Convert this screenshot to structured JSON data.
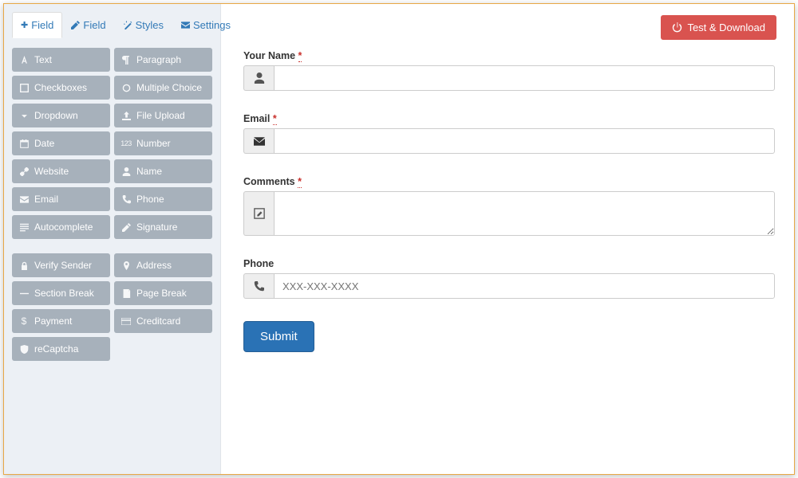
{
  "tabs": [
    {
      "icon": "plus",
      "label": "Field"
    },
    {
      "icon": "edit",
      "label": "Field"
    },
    {
      "icon": "wand",
      "label": "Styles"
    },
    {
      "icon": "envelope",
      "label": "Settings"
    }
  ],
  "activeTab": 0,
  "fieldButtons1": [
    {
      "icon": "font",
      "label": "Text"
    },
    {
      "icon": "para",
      "label": "Paragraph"
    },
    {
      "icon": "square",
      "label": "Checkboxes"
    },
    {
      "icon": "circle",
      "label": "Multiple Choice"
    },
    {
      "icon": "caret",
      "label": "Dropdown"
    },
    {
      "icon": "upload",
      "label": "File Upload"
    },
    {
      "icon": "cal",
      "label": "Date"
    },
    {
      "icon": "num",
      "label": "Number"
    },
    {
      "icon": "link",
      "label": "Website"
    },
    {
      "icon": "user",
      "label": "Name"
    },
    {
      "icon": "envelope",
      "label": "Email"
    },
    {
      "icon": "phone",
      "label": "Phone"
    },
    {
      "icon": "list",
      "label": "Autocomplete"
    },
    {
      "icon": "sig",
      "label": "Signature"
    }
  ],
  "fieldButtons2": [
    {
      "icon": "lock",
      "label": "Verify Sender"
    },
    {
      "icon": "pin",
      "label": "Address"
    },
    {
      "icon": "minus",
      "label": "Section Break"
    },
    {
      "icon": "page",
      "label": "Page Break"
    },
    {
      "icon": "dollar",
      "label": "Payment"
    },
    {
      "icon": "card",
      "label": "Creditcard"
    },
    {
      "icon": "shield",
      "label": "reCaptcha"
    }
  ],
  "testDownload": {
    "label": "Test & Download"
  },
  "form": {
    "fields": [
      {
        "label": "Your Name",
        "required": true,
        "icon": "user",
        "type": "text",
        "placeholder": ""
      },
      {
        "label": "Email",
        "required": true,
        "icon": "mail",
        "type": "text",
        "placeholder": ""
      },
      {
        "label": "Comments",
        "required": true,
        "icon": "edit",
        "type": "textarea",
        "placeholder": ""
      },
      {
        "label": "Phone",
        "required": false,
        "icon": "phone",
        "type": "text",
        "placeholder": "XXX-XXX-XXXX"
      }
    ],
    "submit": "Submit",
    "requiredMark": "*"
  }
}
